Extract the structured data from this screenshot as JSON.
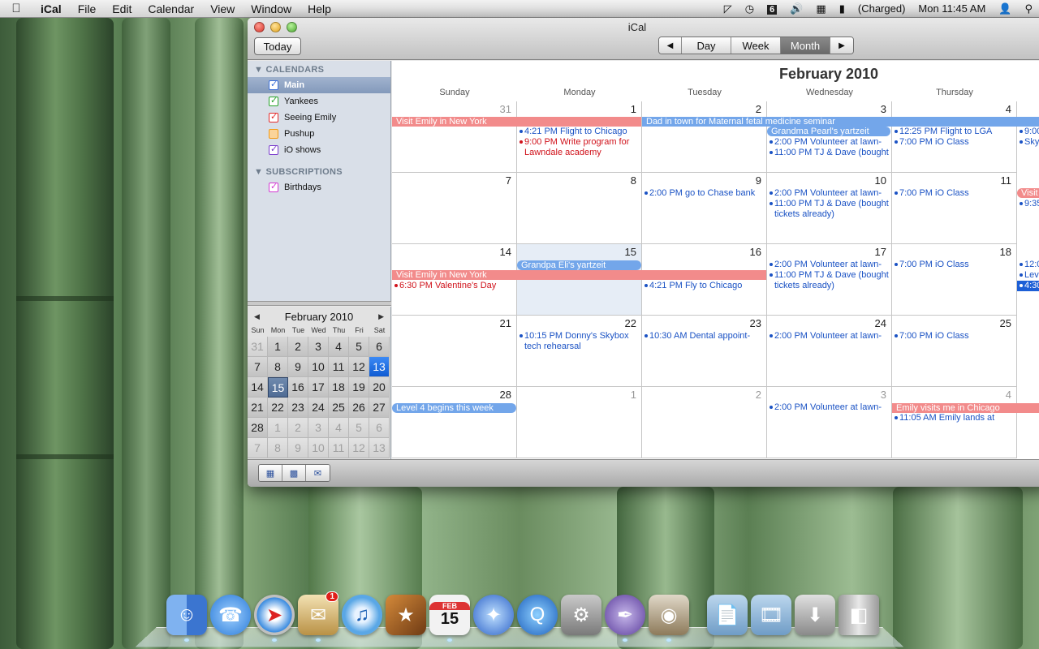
{
  "menubar": {
    "app": "iCal",
    "items": [
      "File",
      "Edit",
      "Calendar",
      "View",
      "Window",
      "Help"
    ],
    "battery": "(Charged)",
    "clock": "Mon 11:45 AM",
    "badge": "6"
  },
  "window": {
    "title": "iCal",
    "today_label": "Today",
    "views": [
      "Day",
      "Week",
      "Month"
    ],
    "active_view": "Month"
  },
  "sidebar": {
    "calendars_header": "CALENDARS",
    "calendars": [
      {
        "name": "Main",
        "color": "#3a6fd8"
      },
      {
        "name": "Yankees",
        "color": "#27a32a"
      },
      {
        "name": "Seeing Emily",
        "color": "#e32b2b"
      },
      {
        "name": "Pushup",
        "color": "#f39a16"
      },
      {
        "name": "iO shows",
        "color": "#7a3ccc"
      }
    ],
    "subscriptions_header": "SUBSCRIPTIONS",
    "subscriptions": [
      {
        "name": "Birthdays",
        "color": "#d23ad2"
      }
    ]
  },
  "mini_calendar": {
    "title": "February 2010",
    "dow": [
      "Sun",
      "Mon",
      "Tue",
      "Wed",
      "Thu",
      "Fri",
      "Sat"
    ],
    "days": [
      "31",
      "1",
      "2",
      "3",
      "4",
      "5",
      "6",
      "7",
      "8",
      "9",
      "10",
      "11",
      "12",
      "13",
      "14",
      "15",
      "16",
      "17",
      "18",
      "19",
      "20",
      "21",
      "22",
      "23",
      "24",
      "25",
      "26",
      "27",
      "28",
      "1",
      "2",
      "3",
      "4",
      "5",
      "6",
      "7",
      "8",
      "9",
      "10",
      "11",
      "12",
      "13"
    ]
  },
  "month": {
    "title": "February 2010",
    "dow": [
      "Sunday",
      "Monday",
      "Tuesday",
      "Wednesday",
      "Thursday"
    ],
    "weeks": [
      [
        "31",
        "1",
        "2",
        "3",
        "4"
      ],
      [
        "7",
        "8",
        "9",
        "10",
        "11"
      ],
      [
        "14",
        "15",
        "16",
        "17",
        "18"
      ],
      [
        "21",
        "22",
        "23",
        "24",
        "25"
      ],
      [
        "28",
        "1",
        "2",
        "3",
        "4"
      ]
    ],
    "bars": {
      "w1_visit_emily": "Visit Emily in New York",
      "w1_dad": "Dad in town for Maternal fetal medicine seminar",
      "w1_pearl": "Grandma Pearl's yartzeit",
      "w3_eli": "Grandpa Eli's yartzeit",
      "w3_visit_emily": "Visit Emily in New York",
      "w5_level4": "Level 4 begins this week",
      "w5_emily_visits": "Emily visits me in Chicago",
      "w2_visit": "Visit"
    },
    "events": {
      "w1_mon_1": "4:21 PM Flight to Chicago",
      "w1_mon_2": "9:00 PM Write program for Lawndale academy",
      "w1_wed_1": "2:00 PM Volunteer at lawn-",
      "w1_wed_2": "11:00 PM TJ & Dave (bought",
      "w1_thu_1": "12:25 PM Flight to LGA",
      "w1_thu_2": "7:00 PM iO Class",
      "w1_fri_1": "9:00",
      "w1_fri_2": "Skyb",
      "w2_tue_1": "2:00 PM go to Chase bank",
      "w2_wed_1": "2:00 PM Volunteer at lawn-",
      "w2_wed_2": "11:00 PM TJ & Dave (bought tickets already)",
      "w2_thu_1": "7:00 PM iO Class",
      "w2_fri_1": "9:35",
      "w3_sun_1": "6:30 PM Valentine's Day",
      "w3_tue_1": "4:21 PM Fly to Chicago",
      "w3_wed_1": "2:00 PM Volunteer at lawn-",
      "w3_wed_2": "11:00 PM TJ & Dave (bought tickets already)",
      "w3_thu_1": "7:00 PM iO Class",
      "w3_fri_1": "12:0",
      "w3_fri_2": "Leve",
      "w3_fri_3": "4:30",
      "w4_mon_1": "10:15 PM Donny's Skybox tech rehearsal",
      "w4_tue_1": "10:30 AM Dental appoint-",
      "w4_wed_1": "2:00 PM Volunteer at lawn-",
      "w4_thu_1": "7:00 PM iO Class",
      "w5_wed_1": "2:00 PM Volunteer at lawn-",
      "w5_thu_1": "11:05 AM Emily lands at"
    }
  },
  "dock": {
    "badge_mail": "1",
    "ical_month": "FEB",
    "ical_day": "15"
  }
}
